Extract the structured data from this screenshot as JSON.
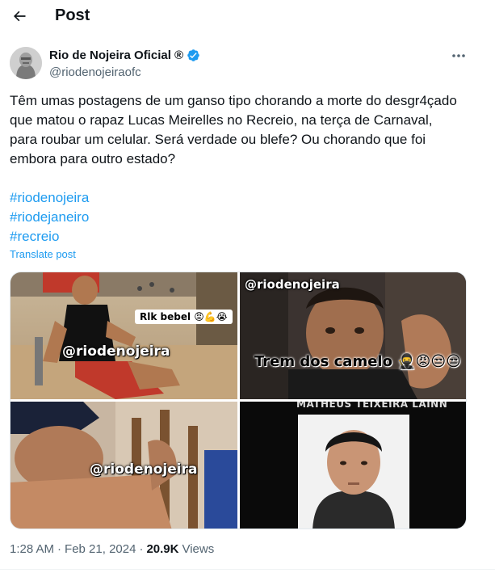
{
  "header": {
    "title": "Post"
  },
  "author": {
    "name": "Rio de Nojeira Oficial ®",
    "handle": "@riodenojeiraofc"
  },
  "post": {
    "text": "Têm umas postagens de um ganso tipo chorando a morte do desgr4çado que matou o rapaz Lucas Meirelles no Recreio, na terça de Carnaval, para roubar um celular. Será verdade ou blefe? Ou chorando que foi embora para outro estado?",
    "hashtags": [
      "#riodenojeira",
      "#riodejaneiro",
      "#recreio"
    ],
    "translate_label": "Translate post"
  },
  "media": {
    "image1": {
      "watermark": "@riodenojeira",
      "sticker": "Rlk bebel",
      "sticker_emoji": "😡💪😭"
    },
    "image2": {
      "watermark": "@riodenojeira",
      "caption": "Trem dos camelo",
      "caption_emoji": "🥷😡😒😒"
    },
    "image3": {
      "watermark": "@riodenojeira"
    },
    "image4": {
      "caption": "MATHEUS TEIXEIRA LAINN"
    }
  },
  "meta": {
    "time": "1:28 AM",
    "separator": "·",
    "date": "Feb 21, 2024",
    "views_count": "20.9K",
    "views_label": "Views"
  },
  "colors": {
    "accent": "#1d9bf0",
    "text": "#0f1419",
    "muted": "#536471"
  },
  "icons": [
    "back-arrow-icon",
    "verified-badge-icon",
    "more-options-icon"
  ]
}
